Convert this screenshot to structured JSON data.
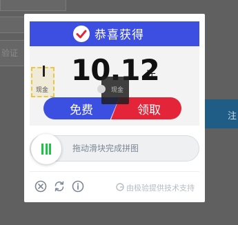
{
  "background": {
    "captcha_hint": "验证",
    "side_button_label": "注"
  },
  "puzzle": {
    "header_title": "恭喜获得",
    "amount": "10.12",
    "unit": "元",
    "free_label": "免费",
    "claim_label": "领取",
    "gift_label": "现金",
    "hole_label": "现金"
  },
  "slider": {
    "hint": "拖动滑块完成拼图"
  },
  "footer": {
    "icons": [
      "close-icon",
      "refresh-icon",
      "info-icon"
    ],
    "brand_text": "由极验提供技术支持"
  },
  "colors": {
    "header_blue": "#3c4fe0",
    "claim_red": "#e42438",
    "grip_green": "#1fc34a"
  }
}
